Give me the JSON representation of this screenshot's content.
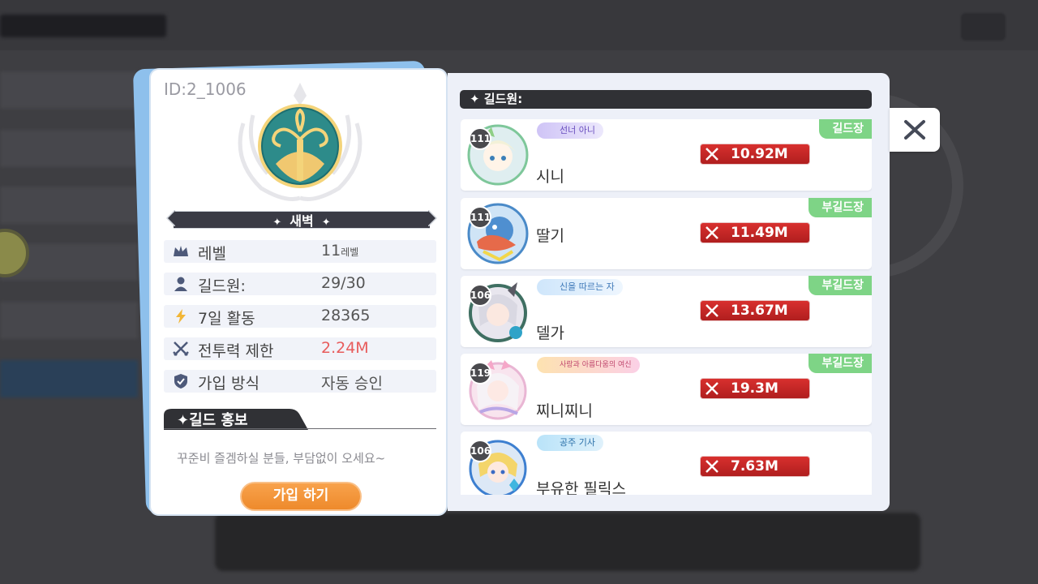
{
  "guild": {
    "id": "ID:2_1006",
    "name": "새벽",
    "name_star": "✦",
    "info": [
      {
        "label": "레벨",
        "value": "11",
        "suffix": "레벨",
        "icon": "crown-icon"
      },
      {
        "label": "길드원:",
        "value": "29/30",
        "suffix": "",
        "icon": "person-icon"
      },
      {
        "label": "7일 활동",
        "value": "28365",
        "suffix": "",
        "icon": "lightning-icon"
      },
      {
        "label": "전투력 제한",
        "value": "2.24M",
        "suffix": "",
        "icon": "crossed-swords-icon"
      },
      {
        "label": "가입 방식",
        "value": "자동 승인",
        "suffix": "",
        "icon": "shield-icon"
      }
    ],
    "promo_title": "✦길드 홍보",
    "promo_text": "꾸준비 즐겜하실 분들, 부담없이 오세요~",
    "join_button": "가입 하기"
  },
  "members": {
    "header": "✦ 길드원:",
    "list": [
      {
        "level": "111",
        "title": "선너 아니",
        "name": "시니",
        "role": "길드장",
        "power": "10.92M",
        "avatar_color": "#dfeef0"
      },
      {
        "level": "111",
        "title": "",
        "name": "딸기",
        "role": "부길드장",
        "power": "11.49M",
        "avatar_color": "#cfe4f6"
      },
      {
        "level": "106",
        "title": "신을 따르는 자",
        "name": "델가",
        "role": "부길드장",
        "power": "13.67M",
        "avatar_color": "#e8e6ee"
      },
      {
        "level": "119",
        "title": "사랑과 아름다움의 여신",
        "name": "찌니찌니",
        "role": "부길드장",
        "power": "19.3M",
        "avatar_color": "#f8e4ee"
      },
      {
        "level": "106",
        "title": "공주 기사",
        "name": "부유한 필릭스",
        "role": "",
        "power": "7.63M",
        "avatar_color": "#dce8f6"
      }
    ]
  },
  "close_icon": "close-icon",
  "colors": {
    "accent_orange": "#ee8a2c",
    "power_red": "#c62828",
    "role_green": "#7ed486",
    "limit_red": "#e85c5c"
  }
}
